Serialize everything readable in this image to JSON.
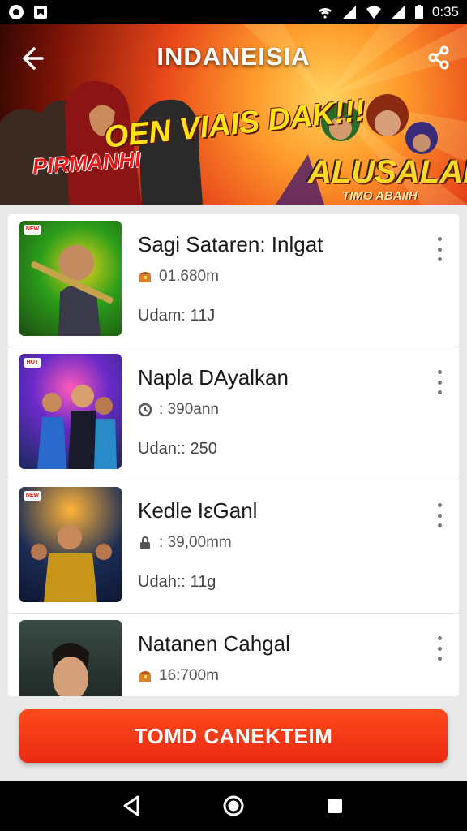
{
  "status_bar": {
    "time": "0:35",
    "left_icons": [
      "camera-app-icon",
      "notification-icon"
    ],
    "right_icons": [
      "wifi-icon",
      "signal-icon",
      "wifi-alt-icon",
      "signal-alt-icon",
      "battery-icon"
    ]
  },
  "banner": {
    "title": "INDANEISIA",
    "slogan": "OEN VIAIS DAK!!!",
    "red_text": "PIRMANHI",
    "logo_text": "ALUSALAIS",
    "logo_sub": "TIMO ABAIIH"
  },
  "list": [
    {
      "title": "Sagi Sataren: Inlgat",
      "meta": "01.680m",
      "meta_icon": "chest-icon",
      "sub": "Udam: 11J",
      "thumb_badge": "NEW",
      "thumb_colors": [
        "#2a7d1a",
        "#e6b31a",
        "#1e4d12"
      ]
    },
    {
      "title": "Napla DAyalkan",
      "meta": ": 390ann",
      "meta_icon": "clock-icon",
      "sub": "Udan:: 250",
      "thumb_badge": "HOT",
      "thumb_colors": [
        "#3a1f6e",
        "#e03aa8",
        "#182a5c"
      ]
    },
    {
      "title": "Kedle IεGanl",
      "meta": ": 39,00mm",
      "meta_icon": "lock-icon",
      "sub": "Udah:: 11g",
      "thumb_badge": "NEW",
      "thumb_colors": [
        "#1c2c55",
        "#c8951b",
        "#0e1632"
      ]
    },
    {
      "title": "Natanen Cahgal",
      "meta": "16:700m",
      "meta_icon": "chest-icon",
      "sub": "",
      "thumb_badge": "",
      "thumb_colors": [
        "#2a3a36",
        "#6b5a4a",
        "#141a18"
      ]
    }
  ],
  "cta": {
    "label": "TOMD CANEKTEIM"
  },
  "colors": {
    "accent": "#ea2a12",
    "background": "#e9e9e9"
  }
}
